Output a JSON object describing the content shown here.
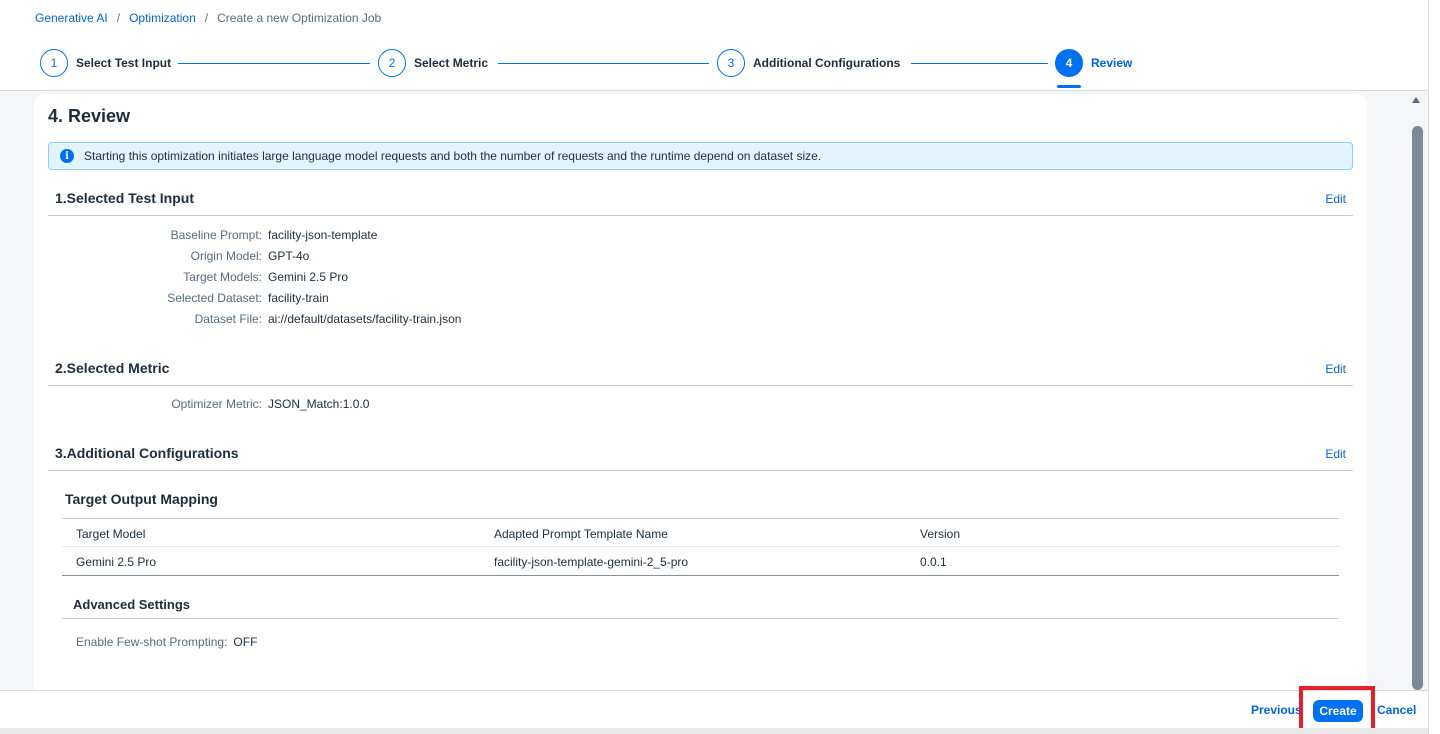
{
  "breadcrumb": {
    "items": [
      "Generative AI",
      "Optimization"
    ],
    "current": "Create a new Optimization Job",
    "separator": "/"
  },
  "wizard": {
    "steps": [
      {
        "number": "1",
        "label": "Select Test Input"
      },
      {
        "number": "2",
        "label": "Select Metric"
      },
      {
        "number": "3",
        "label": "Additional Configurations"
      },
      {
        "number": "4",
        "label": "Review"
      }
    ],
    "active_step": 4
  },
  "review": {
    "title": "4. Review",
    "info_message": "Starting this optimization initiates large language model requests and both the number of requests and the runtime depend on dataset size.",
    "edit_label": "Edit",
    "sections": {
      "test_input": {
        "title": "1.Selected Test Input",
        "fields": [
          {
            "label": "Baseline Prompt:",
            "value": "facility-json-template"
          },
          {
            "label": "Origin Model:",
            "value": "GPT-4o"
          },
          {
            "label": "Target Models:",
            "value": "Gemini 2.5 Pro"
          },
          {
            "label": "Selected Dataset:",
            "value": "facility-train"
          },
          {
            "label": "Dataset File:",
            "value": "ai://default/datasets/facility-train.json"
          }
        ]
      },
      "metric": {
        "title": "2.Selected Metric",
        "fields": [
          {
            "label": "Optimizer Metric:",
            "value": "JSON_Match:1.0.0"
          }
        ]
      },
      "additional": {
        "title": "3.Additional Configurations",
        "mapping_title": "Target Output Mapping",
        "columns": [
          "Target Model",
          "Adapted Prompt Template Name",
          "Version"
        ],
        "rows": [
          [
            "Gemini 2.5 Pro",
            "facility-json-template-gemini-2_5-pro",
            "0.0.1"
          ]
        ],
        "advanced_title": "Advanced Settings",
        "advanced_fields": [
          {
            "label": "Enable Few-shot Prompting:",
            "value": "OFF"
          }
        ]
      }
    }
  },
  "footer": {
    "previous_label": "Previous",
    "create_label": "Create",
    "cancel_label": "Cancel"
  },
  "colors": {
    "accent": "#0070f2",
    "link": "#0064d9",
    "info_bg": "#e1f4ff",
    "highlight": "#e4202a"
  }
}
